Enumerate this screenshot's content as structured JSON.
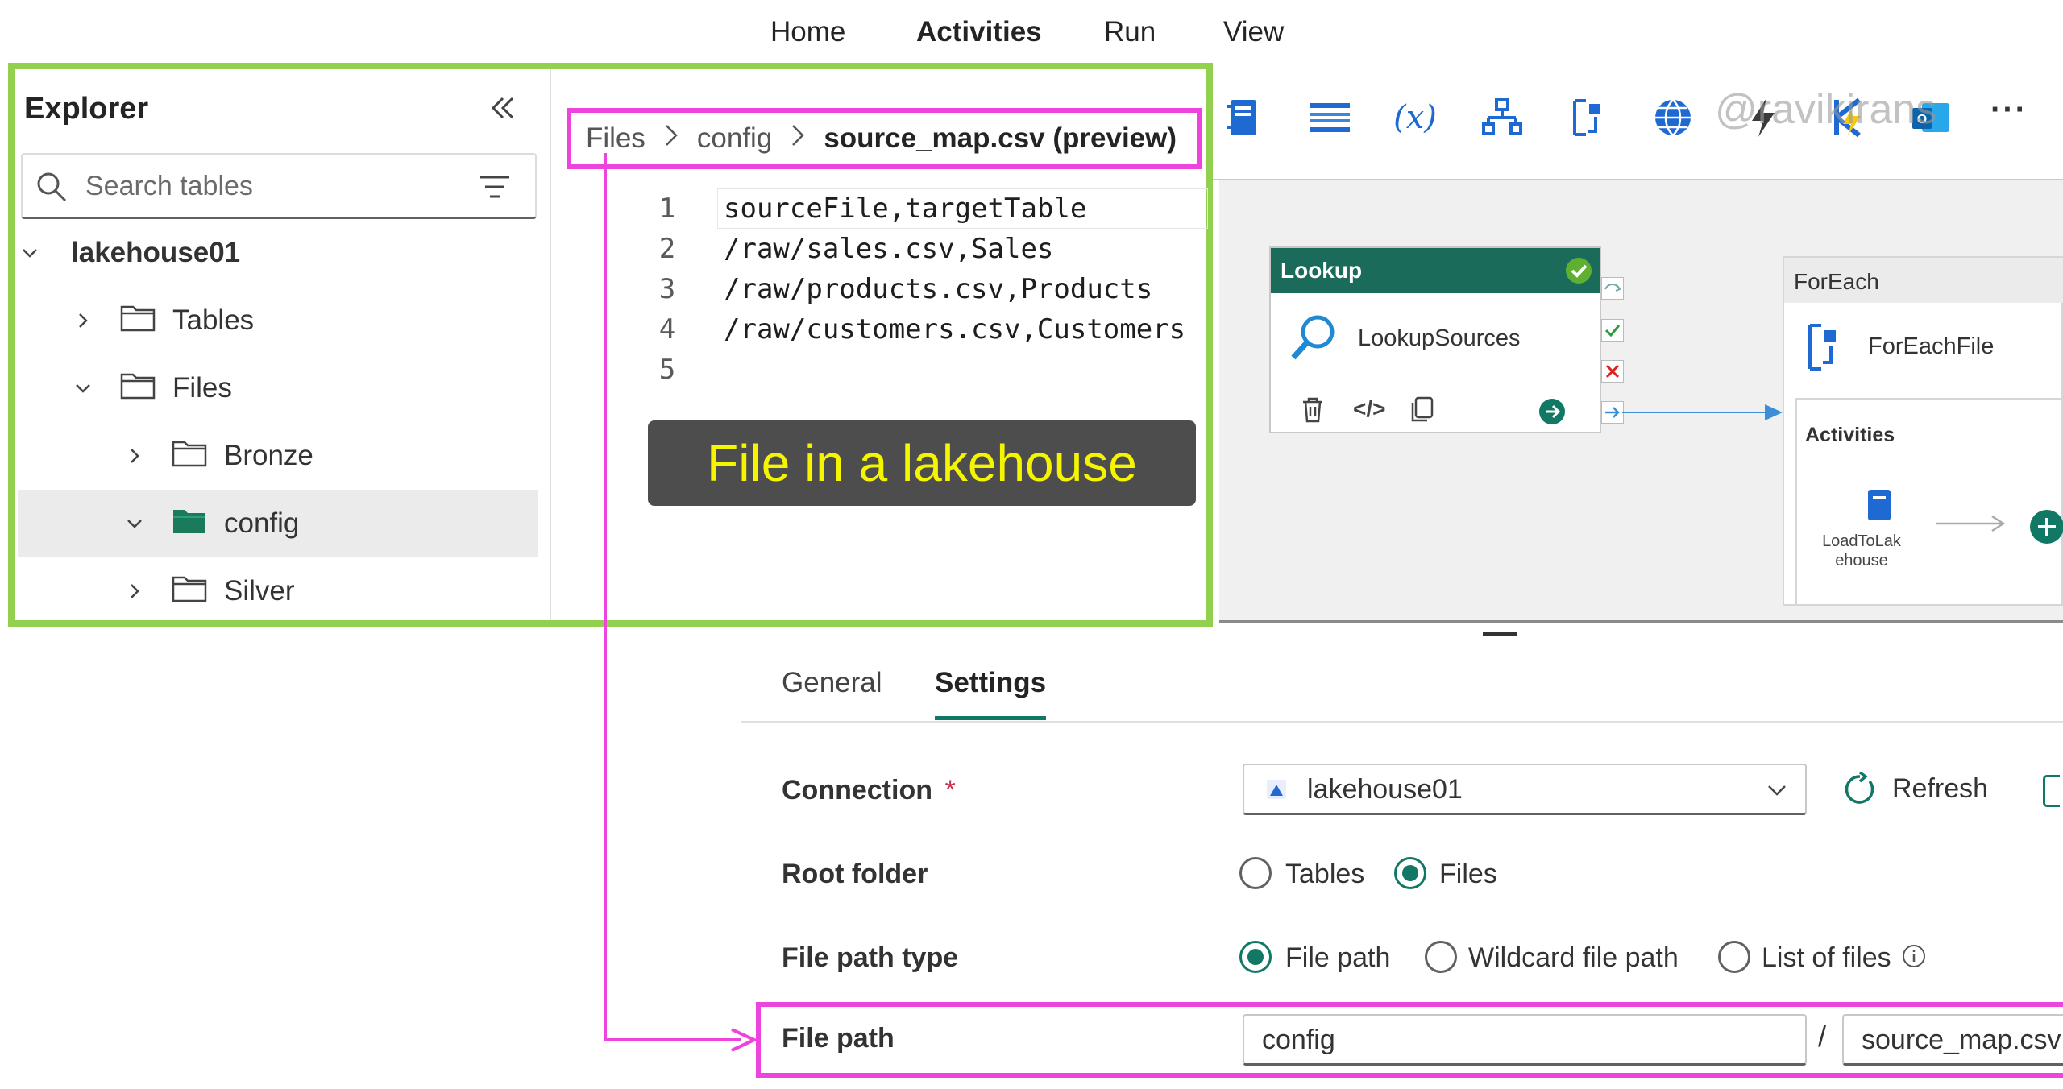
{
  "menu": {
    "items": [
      "Home",
      "Activities",
      "Run",
      "View"
    ],
    "active": "Activities"
  },
  "toolbar": {
    "more": "···",
    "watermark": "@ravikirans"
  },
  "explorer": {
    "title": "Explorer",
    "search_placeholder": "Search tables",
    "tree": {
      "lakehouse": "lakehouse01",
      "tables": "Tables",
      "files": "Files",
      "bronze": "Bronze",
      "config": "config",
      "silver": "Silver"
    }
  },
  "preview": {
    "breadcrumb": [
      "Files",
      "config",
      "source_map.csv (preview)"
    ],
    "lines": [
      {
        "n": "1",
        "text": "sourceFile,targetTable"
      },
      {
        "n": "2",
        "text": "/raw/sales.csv,Sales"
      },
      {
        "n": "3",
        "text": "/raw/products.csv,Products"
      },
      {
        "n": "4",
        "text": "/raw/customers.csv,Customers"
      },
      {
        "n": "5",
        "text": ""
      }
    ],
    "callout": "File in a lakehouse"
  },
  "canvas": {
    "lookup": {
      "header": "Lookup",
      "name": "LookupSources"
    },
    "foreach": {
      "header": "ForEach",
      "name": "ForEachFile",
      "activities_label": "Activities",
      "inner_activity_line1": "LoadToLak",
      "inner_activity_line2": "ehouse"
    }
  },
  "tabs": {
    "general": "General",
    "settings": "Settings",
    "active": "Settings"
  },
  "settings": {
    "connection_label": "Connection",
    "required_mark": "*",
    "connection_value": "lakehouse01",
    "refresh_label": "Refresh",
    "root_folder_label": "Root folder",
    "root_options": [
      "Tables",
      "Files"
    ],
    "root_selected": "Files",
    "file_path_type_label": "File path type",
    "file_path_type_options": [
      "File path",
      "Wildcard file path",
      "List of files"
    ],
    "file_path_type_selected": "File path",
    "file_path_label": "File path",
    "file_path_folder": "config",
    "file_path_separator": "/",
    "file_path_file": "source_map.csv"
  },
  "colors": {
    "highlight_green": "#92d050",
    "highlight_magenta": "#ee44dd",
    "accent": "#117865",
    "callout_bg": "#4d4d4d",
    "callout_text": "#f5f500"
  }
}
